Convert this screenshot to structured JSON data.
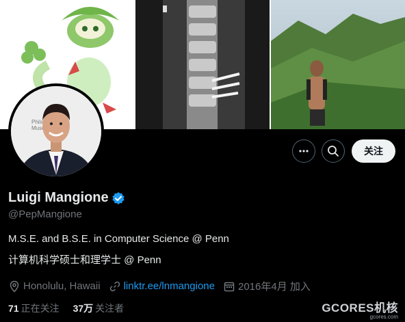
{
  "profile": {
    "name": "Luigi Mangione",
    "handle": "@PepMangione",
    "bio_line1": "M.S.E. and B.S.E. in Computer Science @ Penn",
    "bio_line2": "计算机科学硕士和理学士 @ Penn",
    "location": "Honolulu, Hawaii",
    "link": "linktr.ee/lnmangione",
    "joined": "2016年4月 加入",
    "following_count": "71",
    "following_label": "正在关注",
    "followers_count": "37万",
    "followers_label": "关注者"
  },
  "actions": {
    "follow_label": "关注"
  },
  "colors": {
    "accent": "#1d9bf0",
    "background": "#000000",
    "muted": "#71767b"
  },
  "watermark": {
    "main": "GCORES机核",
    "sub": "gcores.com"
  }
}
